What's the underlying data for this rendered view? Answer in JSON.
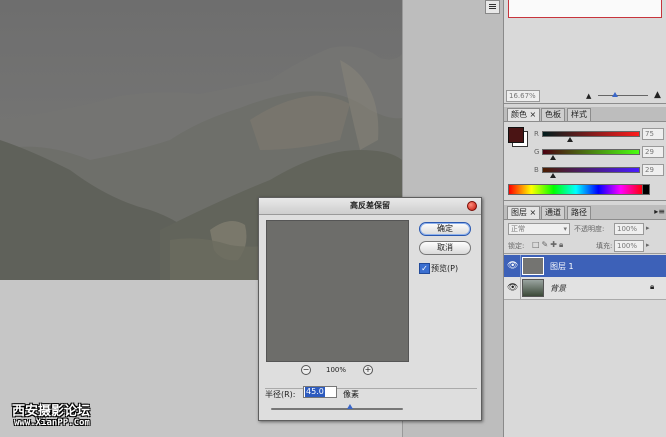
{
  "panels": {
    "navigator": {
      "zoom": "16.67%"
    },
    "color": {
      "tabs": [
        "颜色",
        "色板",
        "样式"
      ],
      "fg_color": "#4a1414",
      "channels": [
        {
          "name": "R",
          "value": "75",
          "fraction": 0.29
        },
        {
          "name": "G",
          "value": "29",
          "fraction": 0.11
        },
        {
          "name": "B",
          "value": "29",
          "fraction": 0.11
        }
      ]
    },
    "layers": {
      "tabs": [
        "图层",
        "通道",
        "路径"
      ],
      "blend_mode": "正常",
      "opacity_label": "不透明度:",
      "opacity_value": "100%",
      "lock_label": "锁定:",
      "fill_label": "填充:",
      "fill_value": "100%",
      "items": [
        {
          "name": "图层 1",
          "selected": true
        },
        {
          "name": "背景",
          "selected": false
        }
      ]
    }
  },
  "dialog": {
    "title": "高反差保留",
    "ok_label": "确定",
    "cancel_label": "取消",
    "preview_label": "预览(P)",
    "preview_checked": true,
    "zoom_value": "100%",
    "zoom_out_symbol": "−",
    "zoom_in_symbol": "+",
    "radius_label": "半径(R):",
    "radius_value": "45.0",
    "unit_label": "像素",
    "radius_slider_fraction": 0.6
  },
  "watermark": {
    "line1": "西安摄影论坛",
    "line2": "www.XianPP.Com"
  }
}
